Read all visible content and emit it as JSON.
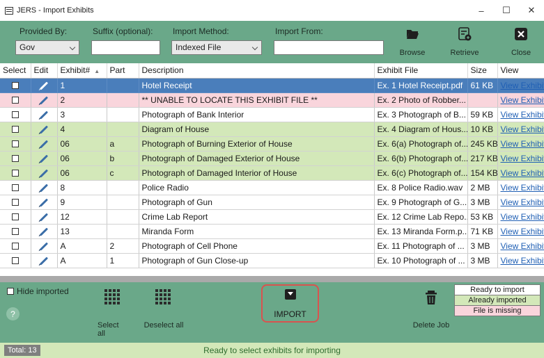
{
  "window": {
    "title": "JERS - Import Exhibits",
    "controls": {
      "minimize": "–",
      "maximize": "☐",
      "close": "✕"
    }
  },
  "toolbar": {
    "provided_by": {
      "label": "Provided By:",
      "value": "Gov"
    },
    "suffix": {
      "label": "Suffix (optional):",
      "value": ""
    },
    "import_method": {
      "label": "Import Method:",
      "value": "Indexed File"
    },
    "import_from": {
      "label": "Import From:",
      "value": ""
    },
    "browse_label": "Browse",
    "retrieve_label": "Retrieve",
    "close_label": "Close"
  },
  "table": {
    "columns": [
      "Select",
      "Edit",
      "Exhibit#",
      "Part",
      "Description",
      "Exhibit File",
      "Size",
      "View"
    ],
    "rows": [
      {
        "state": "sel",
        "exhibit": "1",
        "part": "",
        "description": "Hotel Receipt",
        "file": "Ex. 1 Hotel Receipt.pdf",
        "size": "61 KB",
        "view": "View Exhibit"
      },
      {
        "state": "missing",
        "exhibit": "2",
        "part": "",
        "description": "** UNABLE TO LOCATE THIS EXHIBIT FILE **",
        "file": "Ex. 2 Photo of Robber...",
        "size": "",
        "view": "View Exhibit"
      },
      {
        "state": "ready",
        "exhibit": "3",
        "part": "",
        "description": "Photograph of Bank Interior",
        "file": "Ex. 3 Photograph of B...",
        "size": "59 KB",
        "view": "View Exhibit"
      },
      {
        "state": "imported",
        "exhibit": "4",
        "part": "",
        "description": "Diagram of House",
        "file": "Ex. 4 Diagram of Hous...",
        "size": "10 KB",
        "view": "View Exhibit"
      },
      {
        "state": "imported",
        "exhibit": "06",
        "part": "a",
        "description": "Photograph of Burning Exterior of House",
        "file": "Ex. 6(a) Photograph of...",
        "size": "245 KB",
        "view": "View Exhibit"
      },
      {
        "state": "imported",
        "exhibit": "06",
        "part": "b",
        "description": "Photograph of Damaged Exterior of House",
        "file": "Ex. 6(b) Photograph of...",
        "size": "217 KB",
        "view": "View Exhibit"
      },
      {
        "state": "imported",
        "exhibit": "06",
        "part": "c",
        "description": "Photograph of Damaged Interior of House",
        "file": "Ex. 6(c) Photograph of...",
        "size": "154 KB",
        "view": "View Exhibit"
      },
      {
        "state": "ready",
        "exhibit": "8",
        "part": "",
        "description": "Police Radio",
        "file": "Ex. 8 Police Radio.wav",
        "size": "2 MB",
        "view": "View Exhibit"
      },
      {
        "state": "ready",
        "exhibit": "9",
        "part": "",
        "description": "Photograph of Gun",
        "file": "Ex. 9 Photograph of G...",
        "size": "3 MB",
        "view": "View Exhibit"
      },
      {
        "state": "ready",
        "exhibit": "12",
        "part": "",
        "description": "Crime Lab Report",
        "file": "Ex. 12 Crime Lab Repo...",
        "size": "53 KB",
        "view": "View Exhibit"
      },
      {
        "state": "ready",
        "exhibit": "13",
        "part": "",
        "description": "Miranda Form",
        "file": "Ex. 13 Miranda Form.p...",
        "size": "71 KB",
        "view": "View Exhibit"
      },
      {
        "state": "ready",
        "exhibit": "A",
        "part": "2",
        "description": "Photograph of Cell Phone",
        "file": "Ex. 11 Photograph of ...",
        "size": "3 MB",
        "view": "View Exhibit"
      },
      {
        "state": "ready",
        "exhibit": "A",
        "part": "1",
        "description": "Photograph of Gun Close-up",
        "file": "Ex. 10 Photograph of ...",
        "size": "3 MB",
        "view": "View Exhibit"
      }
    ]
  },
  "bottom": {
    "hide_imported_label": "Hide imported",
    "help": "?",
    "select_all_label": "Select all",
    "deselect_all_label": "Deselect all",
    "import_label": "IMPORT",
    "delete_job_label": "Delete Job",
    "legend": [
      "Ready to import",
      "Already imported",
      "File is missing"
    ]
  },
  "status": {
    "total": "Total: 13",
    "message": "Ready to select exhibits for importing"
  },
  "colors": {
    "panel": "#6aa889",
    "selected_row": "#4a7ebb",
    "imported_row": "#d3e8b9",
    "missing_row": "#f9d5dc",
    "import_highlight": "#d9534f"
  }
}
